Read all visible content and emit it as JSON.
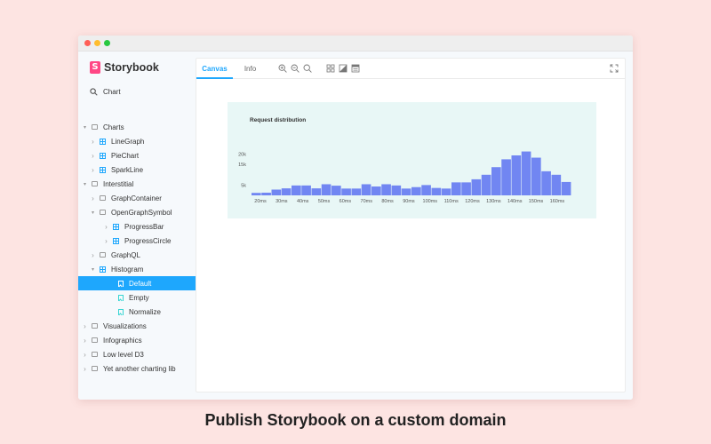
{
  "app": {
    "name": "Storybook"
  },
  "search": {
    "value": "Chart"
  },
  "sidebar": {
    "items": [
      {
        "label": "Charts",
        "kind": "folder",
        "level": 0,
        "expanded": true
      },
      {
        "label": "LineGraph",
        "kind": "component",
        "level": 1,
        "expanded": false
      },
      {
        "label": "PieChart",
        "kind": "component",
        "level": 1,
        "expanded": false
      },
      {
        "label": "SparkLine",
        "kind": "component",
        "level": 1,
        "expanded": false
      },
      {
        "label": "Interstitial",
        "kind": "folder",
        "level": 0,
        "expanded": true
      },
      {
        "label": "GraphContainer",
        "kind": "folder",
        "level": 1,
        "expanded": false
      },
      {
        "label": "OpenGraphSymbol",
        "kind": "folder",
        "level": 1,
        "expanded": true
      },
      {
        "label": "ProgressBar",
        "kind": "component",
        "level": 2,
        "expanded": false
      },
      {
        "label": "ProgressCircle",
        "kind": "component",
        "level": 2,
        "expanded": false
      },
      {
        "label": "GraphQL",
        "kind": "folder",
        "level": 1,
        "expanded": false
      },
      {
        "label": "Histogram",
        "kind": "component",
        "level": 1,
        "expanded": true
      },
      {
        "label": "Default",
        "kind": "story",
        "level": 2,
        "active": true
      },
      {
        "label": "Empty",
        "kind": "story",
        "level": 2
      },
      {
        "label": "Normalize",
        "kind": "story",
        "level": 2
      },
      {
        "label": "Visualizations",
        "kind": "folder",
        "level": 0,
        "expanded": false
      },
      {
        "label": "Infographics",
        "kind": "folder",
        "level": 0,
        "expanded": false
      },
      {
        "label": "Low level D3",
        "kind": "folder",
        "level": 0,
        "expanded": false
      },
      {
        "label": "Yet another charting lib",
        "kind": "folder",
        "level": 0,
        "expanded": false
      }
    ]
  },
  "toolbar": {
    "tabs": [
      {
        "label": "Canvas",
        "active": true
      },
      {
        "label": "Info",
        "active": false
      }
    ],
    "icons": [
      "zoom-in-icon",
      "zoom-out-icon",
      "zoom-reset-icon",
      "grid-icon",
      "background-icon",
      "outline-icon",
      "fullscreen-icon"
    ]
  },
  "chart_data": {
    "type": "bar",
    "title": "Request distribution",
    "xlabel": "",
    "ylabel": "",
    "ylim": [
      0,
      22000
    ],
    "y_ticks": [
      "5k",
      "15k",
      "20k"
    ],
    "x_tick_labels": [
      "20ms",
      "30ms",
      "40ms",
      "50ms",
      "60ms",
      "70ms",
      "80ms",
      "90ms",
      "100ms",
      "110ms",
      "120ms",
      "130ms",
      "140ms",
      "150ms",
      "160ms"
    ],
    "values": [
      1200,
      1300,
      2800,
      3400,
      4800,
      4800,
      3400,
      5400,
      4700,
      3300,
      3300,
      5400,
      4300,
      5400,
      4800,
      3300,
      4000,
      5000,
      3600,
      3300,
      6300,
      6300,
      7800,
      10000,
      13700,
      17500,
      19400,
      21300,
      18300,
      11700,
      10000,
      6500
    ],
    "bar_color": "#7186f2",
    "background": "#e8f7f6",
    "grid": false,
    "legend": "none"
  },
  "caption": {
    "text": "Publish Storybook on a custom domain"
  },
  "colors": {
    "accent": "#1ea7fd",
    "brand": "#ff4785",
    "page_background": "#fde4e2"
  }
}
